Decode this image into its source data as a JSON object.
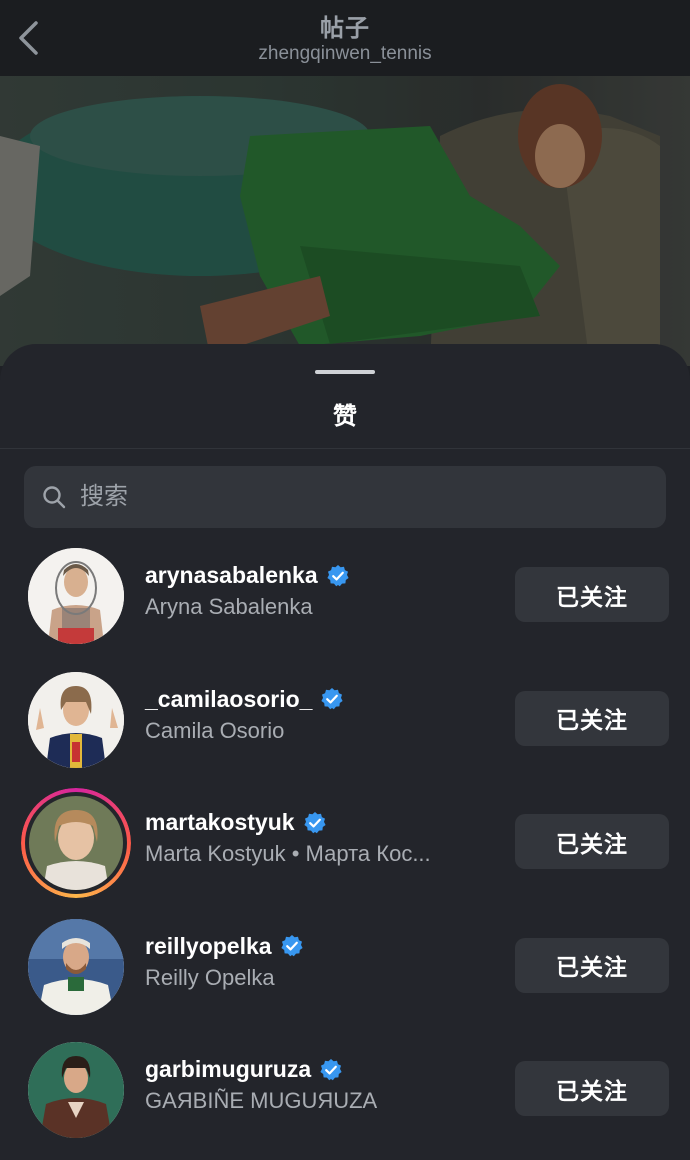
{
  "header": {
    "title": "帖子",
    "subtitle": "zhengqinwen_tennis"
  },
  "sheet": {
    "title": "赞",
    "search_placeholder": "搜索"
  },
  "users": [
    {
      "username": "arynasabalenka",
      "full_name": "Aryna Sabalenka",
      "verified": true,
      "has_story": false,
      "button": "已关注"
    },
    {
      "username": "_camilaosorio_",
      "full_name": "Camila Osorio",
      "verified": true,
      "has_story": false,
      "button": "已关注"
    },
    {
      "username": "martakostyuk",
      "full_name": "Marta Kostyuk • Марта Кос...",
      "verified": true,
      "has_story": true,
      "button": "已关注"
    },
    {
      "username": "reillyopelka",
      "full_name": "Reilly Opelka",
      "verified": true,
      "has_story": false,
      "button": "已关注"
    },
    {
      "username": "garbimuguruza",
      "full_name": "GAЯBIÑE MUGUЯUZA",
      "verified": true,
      "has_story": false,
      "button": "已关注"
    }
  ],
  "colors": {
    "background": "#23252b",
    "navbar": "#1b1d20",
    "button_bg": "#33363c",
    "verified_badge": "#3897f0",
    "secondary_text": "#a9adb3"
  },
  "icons": {
    "back": "chevron-left-icon",
    "search": "search-icon",
    "verified": "verified-badge-icon"
  }
}
